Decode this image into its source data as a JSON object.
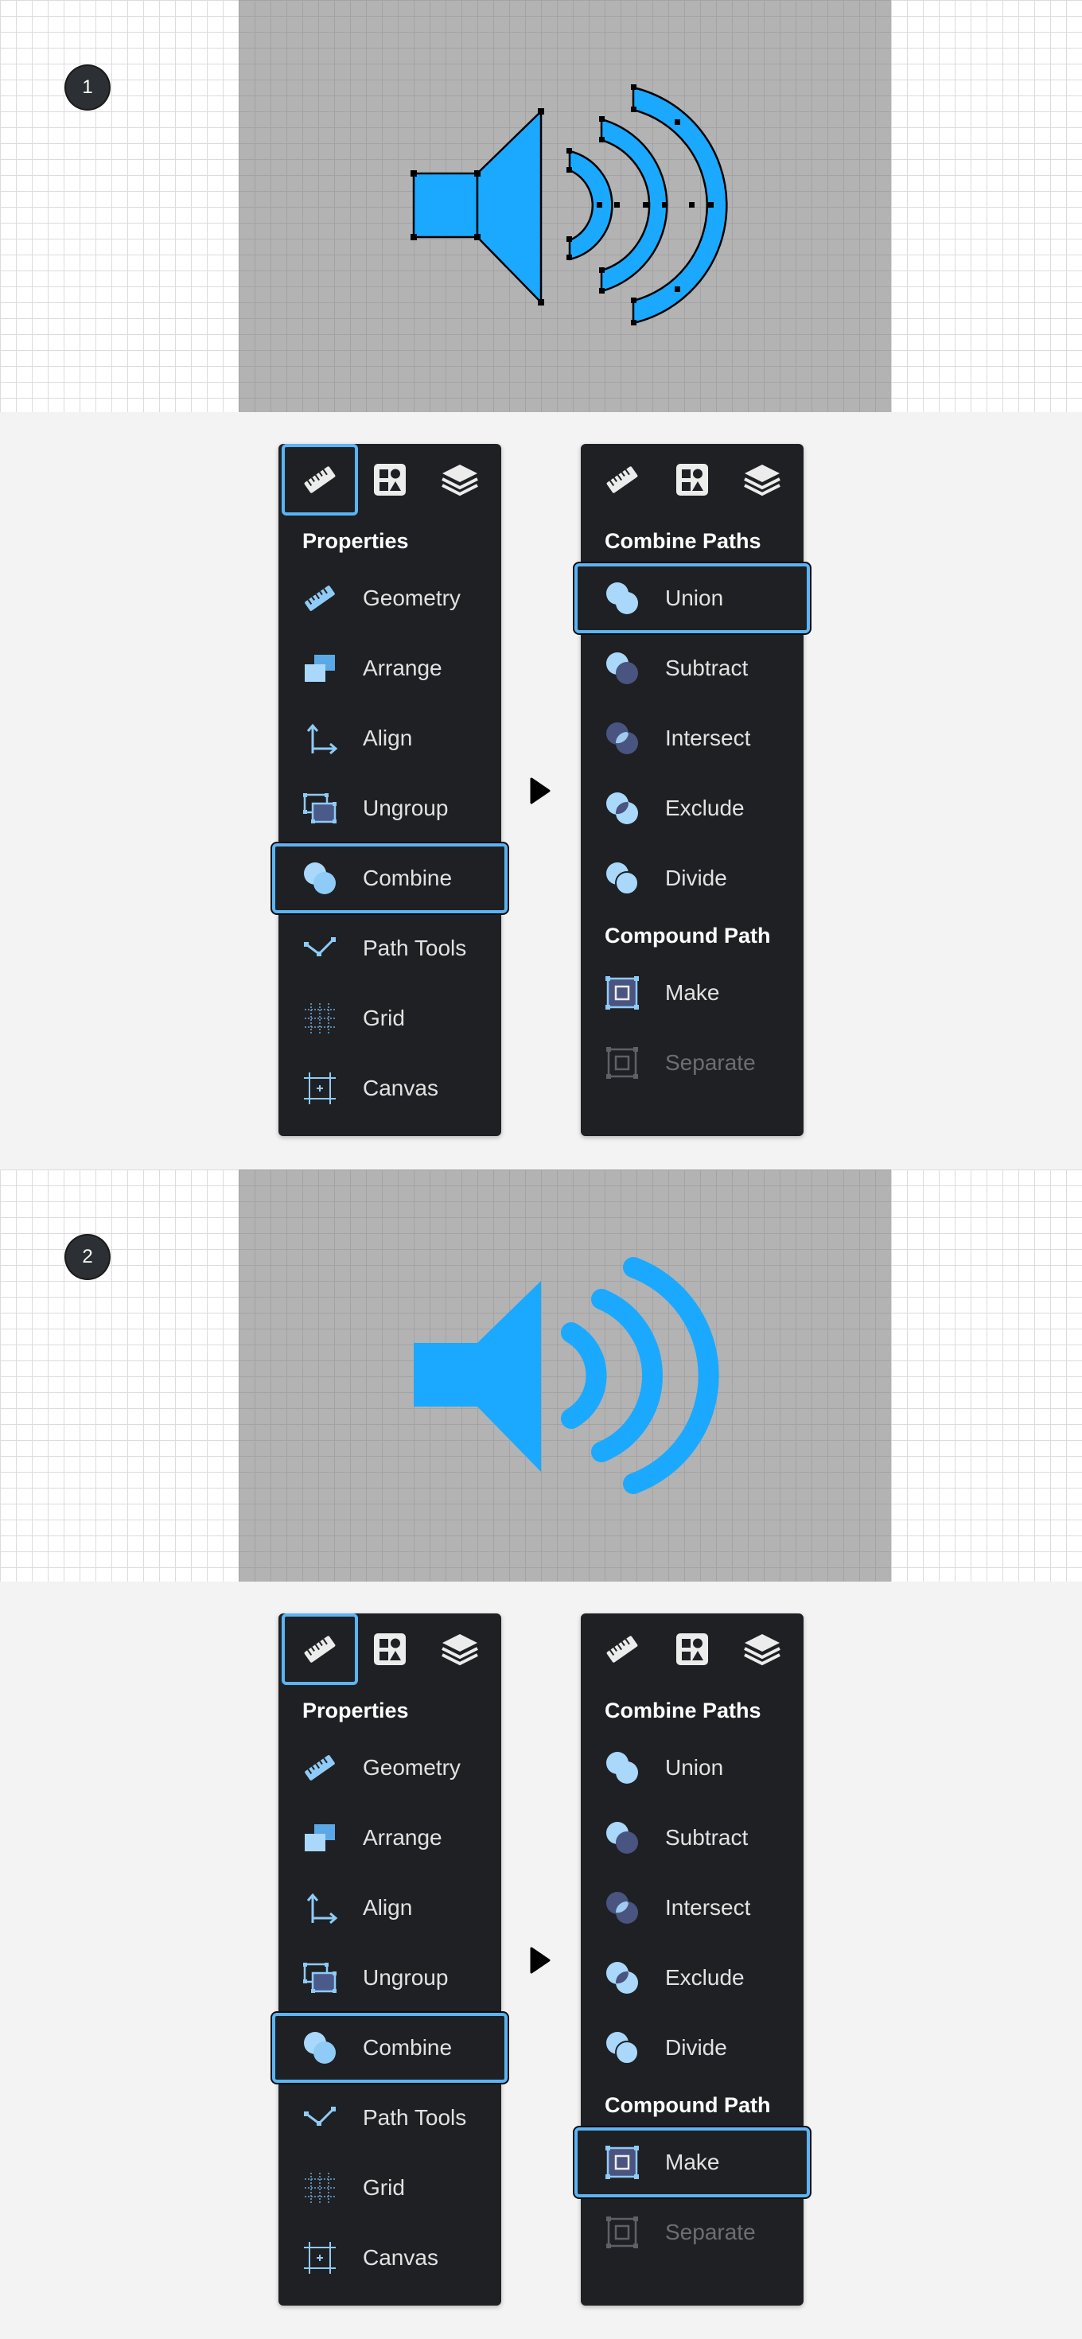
{
  "steps": [
    {
      "badge": "1",
      "left_panel": {
        "tabs": [
          "ruler-icon",
          "shapes-icon",
          "layers-icon"
        ],
        "selected_tab": 0,
        "title": "Properties",
        "items": [
          {
            "label": "Geometry",
            "icon": "ruler-icon"
          },
          {
            "label": "Arrange",
            "icon": "arrange-icon"
          },
          {
            "label": "Align",
            "icon": "align-icon"
          },
          {
            "label": "Ungroup",
            "icon": "ungroup-icon"
          },
          {
            "label": "Combine",
            "icon": "combine-icon",
            "selected": true
          },
          {
            "label": "Path Tools",
            "icon": "path-tools-icon"
          },
          {
            "label": "Grid",
            "icon": "grid-icon"
          },
          {
            "label": "Canvas",
            "icon": "canvas-icon"
          }
        ]
      },
      "right_panel": {
        "tabs": [
          "ruler-icon",
          "shapes-icon",
          "layers-icon"
        ],
        "combine_title": "Combine Paths",
        "combine_items": [
          {
            "label": "Union",
            "icon": "union-icon",
            "selected": true
          },
          {
            "label": "Subtract",
            "icon": "subtract-icon"
          },
          {
            "label": "Intersect",
            "icon": "intersect-icon"
          },
          {
            "label": "Exclude",
            "icon": "exclude-icon"
          },
          {
            "label": "Divide",
            "icon": "divide-icon"
          }
        ],
        "compound_title": "Compound Path",
        "compound_items": [
          {
            "label": "Make",
            "icon": "make-icon"
          },
          {
            "label": "Separate",
            "icon": "separate-icon",
            "disabled": true
          }
        ]
      }
    },
    {
      "badge": "2",
      "left_panel": {
        "tabs": [
          "ruler-icon",
          "shapes-icon",
          "layers-icon"
        ],
        "selected_tab": 0,
        "title": "Properties",
        "items": [
          {
            "label": "Geometry",
            "icon": "ruler-icon"
          },
          {
            "label": "Arrange",
            "icon": "arrange-icon"
          },
          {
            "label": "Align",
            "icon": "align-icon"
          },
          {
            "label": "Ungroup",
            "icon": "ungroup-icon"
          },
          {
            "label": "Combine",
            "icon": "combine-icon",
            "selected": true
          },
          {
            "label": "Path Tools",
            "icon": "path-tools-icon"
          },
          {
            "label": "Grid",
            "icon": "grid-icon"
          },
          {
            "label": "Canvas",
            "icon": "canvas-icon"
          }
        ]
      },
      "right_panel": {
        "tabs": [
          "ruler-icon",
          "shapes-icon",
          "layers-icon"
        ],
        "combine_title": "Combine Paths",
        "combine_items": [
          {
            "label": "Union",
            "icon": "union-icon"
          },
          {
            "label": "Subtract",
            "icon": "subtract-icon"
          },
          {
            "label": "Intersect",
            "icon": "intersect-icon"
          },
          {
            "label": "Exclude",
            "icon": "exclude-icon"
          },
          {
            "label": "Divide",
            "icon": "divide-icon"
          }
        ],
        "compound_title": "Compound Path",
        "compound_items": [
          {
            "label": "Make",
            "icon": "make-icon",
            "selected": true
          },
          {
            "label": "Separate",
            "icon": "separate-icon",
            "disabled": true
          }
        ]
      }
    }
  ],
  "colors": {
    "accent": "#5bb4f5",
    "artwork": "#1aa9ff",
    "panel_bg": "#1f2023",
    "canvas_gray": "#b3b3b3"
  }
}
